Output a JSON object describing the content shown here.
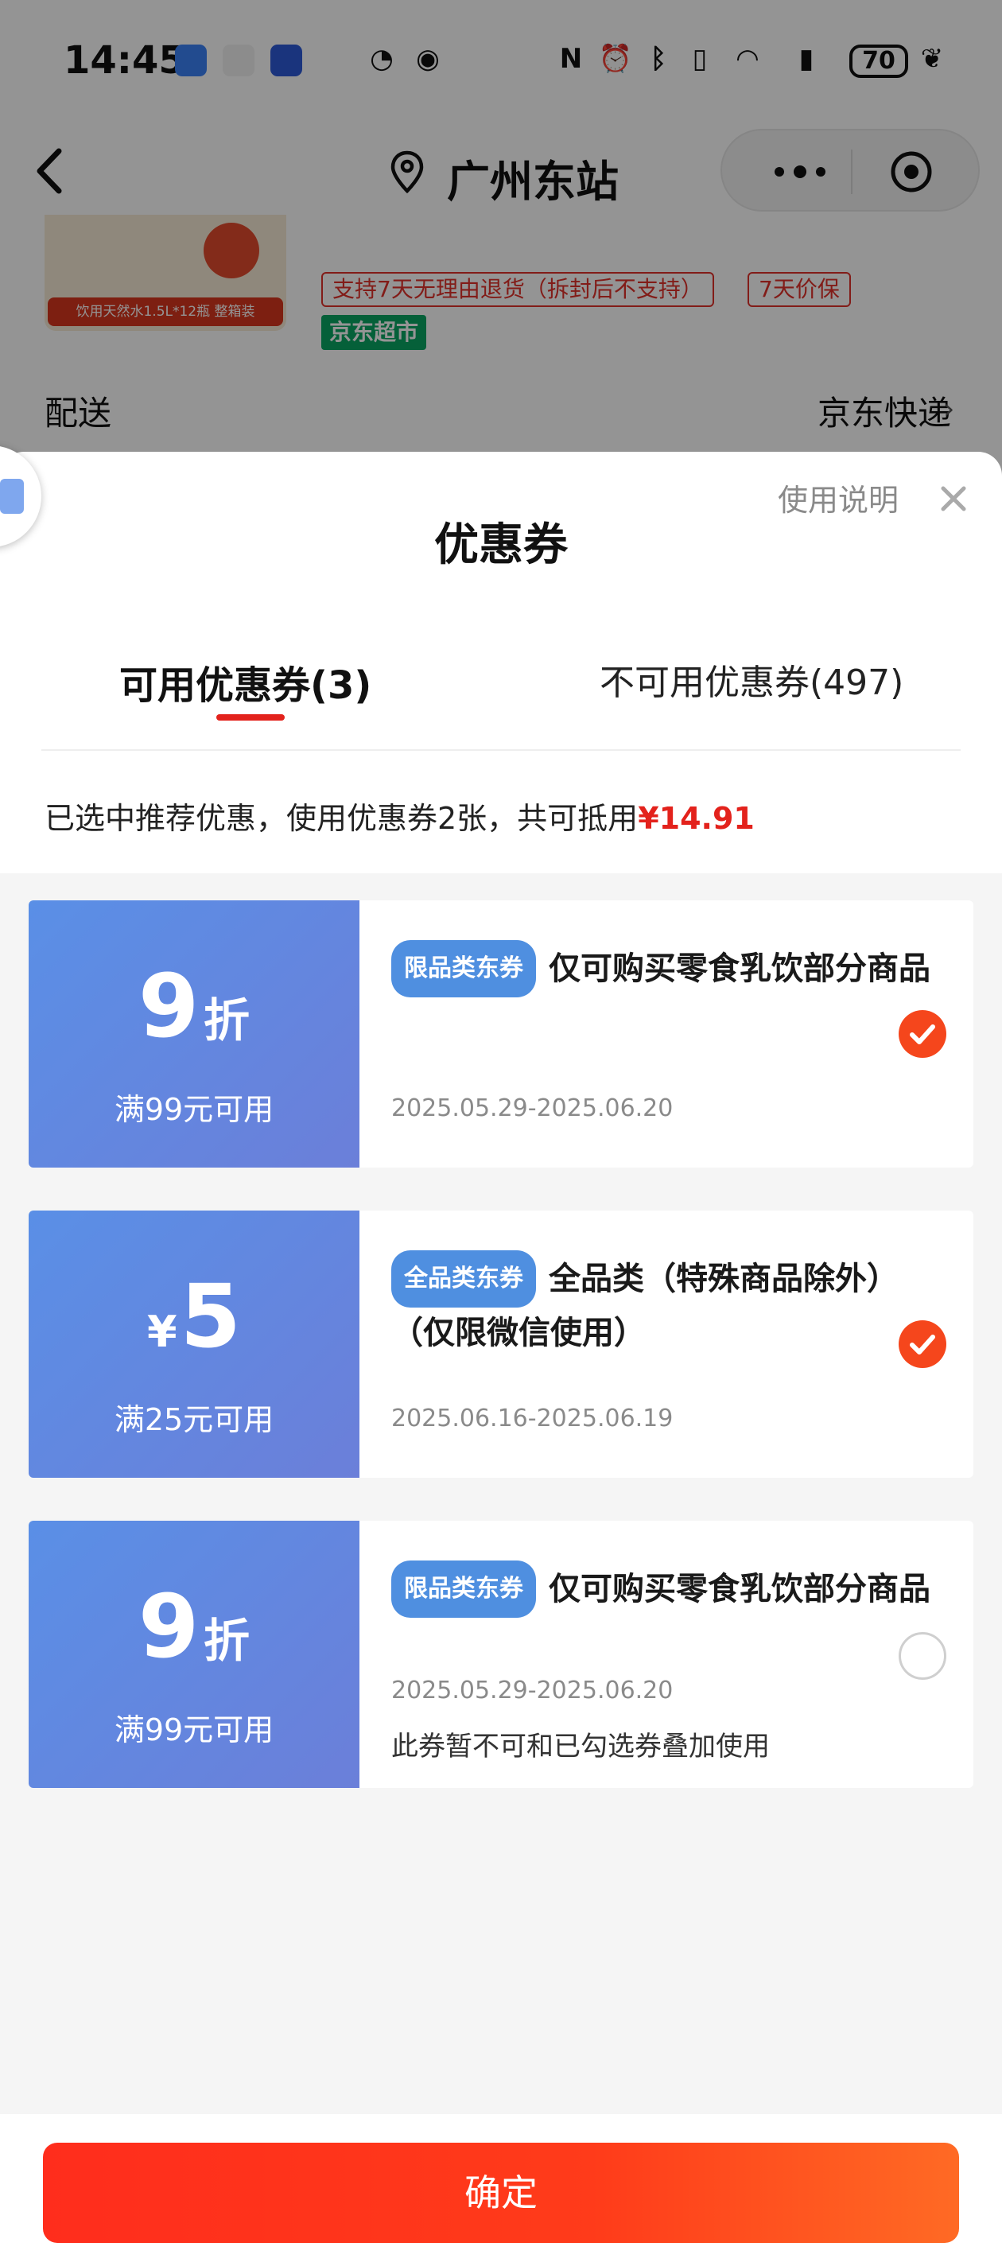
{
  "status_bar": {
    "time": "14:45",
    "battery": "70"
  },
  "nav": {
    "location": "广州东站"
  },
  "background": {
    "product_strip": "饮用天然水1.5L*12瓶 整箱装",
    "tags": [
      "支持7天无理由退货（拆封后不支持）",
      "7天价保"
    ],
    "jd_tag": "京东超市",
    "delivery_label": "配送",
    "delivery_value": "京东快递"
  },
  "sheet": {
    "usage_link": "使用说明",
    "title": "优惠券",
    "tabs": [
      {
        "label": "可用优惠券(3)",
        "active": true
      },
      {
        "label": "不可用优惠券(497)",
        "active": false
      }
    ],
    "summary_text": "已选中推荐优惠，使用优惠券2张，共可抵用",
    "summary_amount": "¥14.91"
  },
  "coupons": [
    {
      "value": "9",
      "unit": "折",
      "prefix": "",
      "condition": "满99元可用",
      "badge": "限品类东券",
      "title": "仅可购买零食乳饮部分商品",
      "date": "2025.05.29-2025.06.20",
      "note": "",
      "selected": true
    },
    {
      "value": "5",
      "unit": "",
      "prefix": "¥",
      "condition": "满25元可用",
      "badge": "全品类东券",
      "title": "全品类（特殊商品除外）（仅限微信使用）",
      "date": "2025.06.16-2025.06.19",
      "note": "",
      "selected": true
    },
    {
      "value": "9",
      "unit": "折",
      "prefix": "",
      "condition": "满99元可用",
      "badge": "限品类东券",
      "title": "仅可购买零食乳饮部分商品",
      "date": "2025.05.29-2025.06.20",
      "note": "此券暂不可和已勾选券叠加使用",
      "selected": false
    }
  ],
  "footer": {
    "confirm_label": "确定"
  },
  "colors": {
    "accent_red": "#e3221c",
    "coupon_blue": "#5a8fe6",
    "check_orange": "#f5461c"
  }
}
